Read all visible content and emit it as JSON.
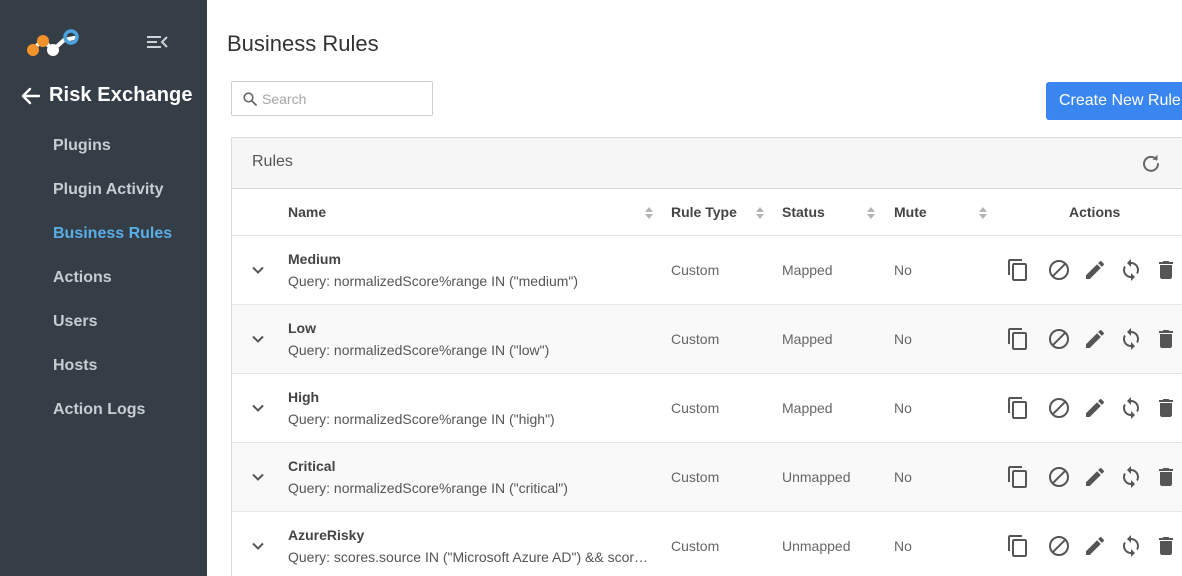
{
  "sidebar": {
    "back_title": "Risk Exchange",
    "items": [
      {
        "label": "Plugins",
        "active": false
      },
      {
        "label": "Plugin Activity",
        "active": false
      },
      {
        "label": "Business Rules",
        "active": true
      },
      {
        "label": "Actions",
        "active": false
      },
      {
        "label": "Users",
        "active": false
      },
      {
        "label": "Hosts",
        "active": false
      },
      {
        "label": "Action Logs",
        "active": false
      }
    ]
  },
  "header": {
    "title": "Business Rules",
    "create_button": "Create New Rule"
  },
  "search": {
    "placeholder": "Search",
    "value": ""
  },
  "panel": {
    "title": "Rules"
  },
  "table": {
    "columns": {
      "name": "Name",
      "rule_type": "Rule Type",
      "status": "Status",
      "mute": "Mute",
      "actions": "Actions"
    },
    "rows": [
      {
        "name": "Medium",
        "query": "Query: normalizedScore%range IN (\"medium\")",
        "rule_type": "Custom",
        "status": "Mapped",
        "mute": "No"
      },
      {
        "name": "Low",
        "query": "Query: normalizedScore%range IN (\"low\")",
        "rule_type": "Custom",
        "status": "Mapped",
        "mute": "No"
      },
      {
        "name": "High",
        "query": "Query: normalizedScore%range IN (\"high\")",
        "rule_type": "Custom",
        "status": "Mapped",
        "mute": "No"
      },
      {
        "name": "Critical",
        "query": "Query: normalizedScore%range IN (\"critical\")",
        "rule_type": "Custom",
        "status": "Unmapped",
        "mute": "No"
      },
      {
        "name": "AzureRisky",
        "query": "Query: scores.source IN (\"Microsoft Azure AD\") && scores.value IN (\"high\")",
        "rule_type": "Custom",
        "status": "Unmapped",
        "mute": "No"
      }
    ]
  },
  "icons": {
    "logo": "netskope-logo",
    "collapse": "menu-collapse-icon",
    "back": "arrow-left-icon",
    "search": "search-icon",
    "refresh": "refresh-icon",
    "sort": "sort-icon",
    "expand": "chevron-down-icon",
    "row_actions": [
      "copy-icon",
      "block-icon",
      "edit-icon",
      "sync-icon",
      "delete-icon"
    ]
  },
  "colors": {
    "sidebar_bg": "#353d46",
    "active_nav": "#5aaee8",
    "primary_button": "#3a86f0",
    "logo_orange": "#f0932b",
    "logo_blue": "#4aa3df"
  }
}
